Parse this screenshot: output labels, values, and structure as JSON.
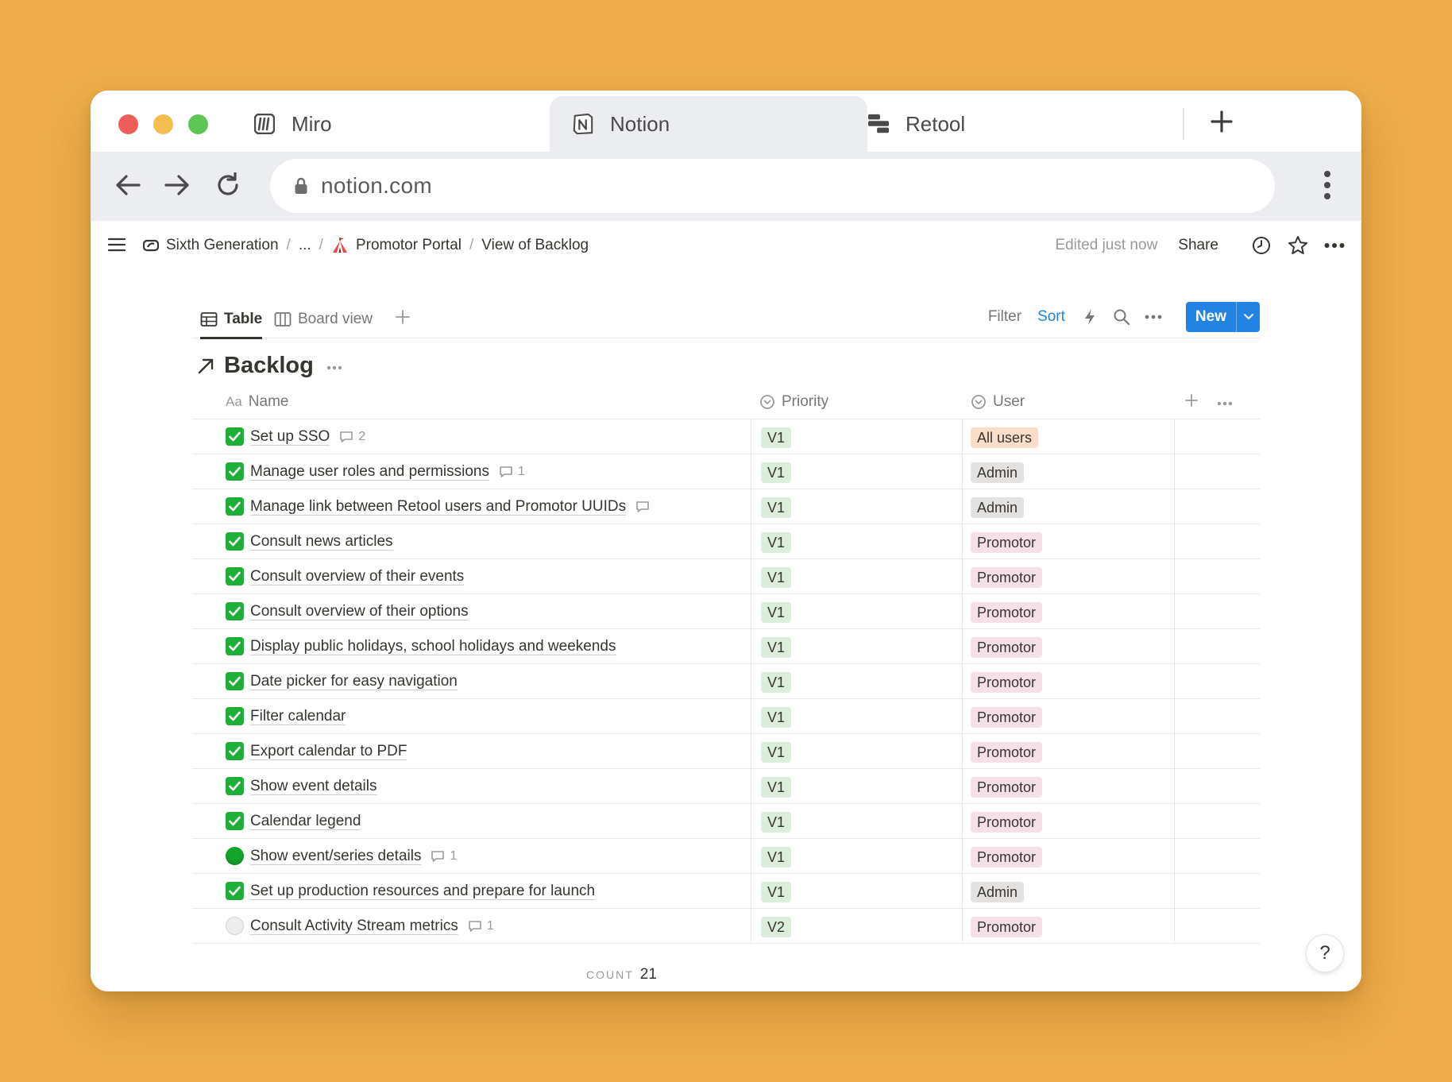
{
  "browser": {
    "tabs": [
      {
        "label": "Miro",
        "icon": "miro-icon"
      },
      {
        "label": "Notion",
        "icon": "notion-icon",
        "active": true
      },
      {
        "label": "Retool",
        "icon": "retool-icon"
      }
    ],
    "url": "notion.com"
  },
  "topbar": {
    "breadcrumbs": [
      {
        "label": "Sixth Generation"
      },
      {
        "label": "..."
      },
      {
        "label": "Promotor Portal"
      },
      {
        "label": "View of Backlog"
      }
    ],
    "edited": "Edited just now",
    "share": "Share"
  },
  "views": {
    "tabs": [
      {
        "label": "Table"
      },
      {
        "label": "Board view"
      }
    ],
    "filter": "Filter",
    "sort": "Sort",
    "new": "New"
  },
  "database": {
    "title": "Backlog",
    "columns": {
      "name": "Name",
      "name_prefix": "Aa",
      "priority": "Priority",
      "user": "User"
    },
    "rows": [
      {
        "status": "done",
        "name": "Set up SSO",
        "comments": "2",
        "priority": "V1",
        "user": "All users",
        "user_type": "allusers"
      },
      {
        "status": "done",
        "name": "Manage user roles and permissions",
        "comments": "1",
        "priority": "V1",
        "user": "Admin",
        "user_type": "admin"
      },
      {
        "status": "done",
        "name": "Manage link between Retool users and Promotor UUIDs",
        "comments": "",
        "priority": "V1",
        "user": "Admin",
        "user_type": "admin"
      },
      {
        "status": "done",
        "name": "Consult news articles",
        "comments": null,
        "priority": "V1",
        "user": "Promotor",
        "user_type": "promotor"
      },
      {
        "status": "done",
        "name": "Consult overview of their events",
        "comments": null,
        "priority": "V1",
        "user": "Promotor",
        "user_type": "promotor"
      },
      {
        "status": "done",
        "name": "Consult overview of their options",
        "comments": null,
        "priority": "V1",
        "user": "Promotor",
        "user_type": "promotor"
      },
      {
        "status": "done",
        "name": "Display public holidays, school holidays and weekends",
        "comments": null,
        "priority": "V1",
        "user": "Promotor",
        "user_type": "promotor"
      },
      {
        "status": "done",
        "name": "Date picker for easy navigation",
        "comments": null,
        "priority": "V1",
        "user": "Promotor",
        "user_type": "promotor"
      },
      {
        "status": "done",
        "name": "Filter calendar",
        "comments": null,
        "priority": "V1",
        "user": "Promotor",
        "user_type": "promotor"
      },
      {
        "status": "done",
        "name": "Export calendar to PDF",
        "comments": null,
        "priority": "V1",
        "user": "Promotor",
        "user_type": "promotor"
      },
      {
        "status": "done",
        "name": "Show event details",
        "comments": null,
        "priority": "V1",
        "user": "Promotor",
        "user_type": "promotor"
      },
      {
        "status": "done",
        "name": "Calendar legend",
        "comments": null,
        "priority": "V1",
        "user": "Promotor",
        "user_type": "promotor"
      },
      {
        "status": "progress",
        "name": "Show event/series details",
        "comments": "1",
        "priority": "V1",
        "user": "Promotor",
        "user_type": "promotor"
      },
      {
        "status": "done",
        "name": "Set up production resources and prepare for launch",
        "comments": null,
        "priority": "V1",
        "user": "Admin",
        "user_type": "admin"
      },
      {
        "status": "todo",
        "name": "Consult Activity Stream metrics",
        "comments": "1",
        "priority": "V2",
        "user": "Promotor",
        "user_type": "promotor"
      }
    ],
    "count_label": "COUNT",
    "count_value": "21"
  },
  "help": "?"
}
